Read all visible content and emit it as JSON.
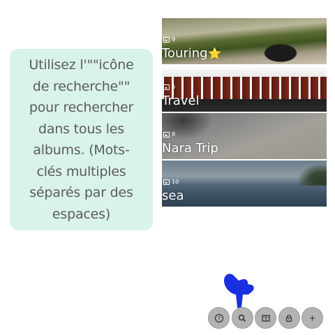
{
  "tooltip": {
    "text": "Utilisez l'\"\"icône\nde recherche\"\"\npour rechercher\ndans tous les\nalbums. (Mots-\nclés multiples\nséparés par des\nespaces)"
  },
  "albums": [
    {
      "count": "9",
      "title": "Touring",
      "star": "⭐"
    },
    {
      "count": "6",
      "title": "Travel",
      "star": ""
    },
    {
      "count": "8",
      "title": "Nara Trip",
      "star": ""
    },
    {
      "count": "10",
      "title": "sea",
      "star": ""
    }
  ],
  "toolbar": {
    "help_glyph": "?",
    "search_glyph": "search",
    "albums_glyph": "album",
    "lock_glyph": "lock",
    "add_glyph": "+"
  },
  "colors": {
    "tooltip_bg": "#d9f3ec",
    "tooltip_text": "#5b5b5b",
    "hand": "#1a2fe0",
    "toolbar_button": "#b3b3b3"
  }
}
